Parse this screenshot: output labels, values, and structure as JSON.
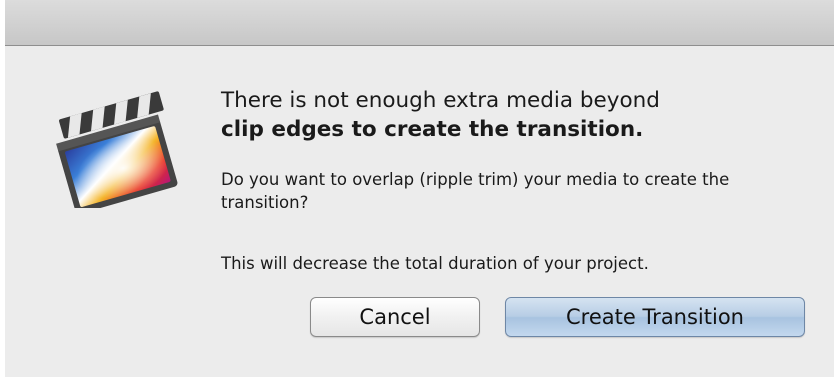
{
  "dialog": {
    "heading_line1": "There is not enough extra media beyond",
    "heading_line2": "clip edges to create the transition.",
    "question": "Do you want to overlap (ripple trim) your media to create the transition?",
    "note": "This will decrease the total duration of your project.",
    "icon": "final-cut-pro-clapperboard-icon"
  },
  "buttons": {
    "cancel_label": "Cancel",
    "create_label": "Create Transition",
    "default_color": "#b7cde5"
  }
}
